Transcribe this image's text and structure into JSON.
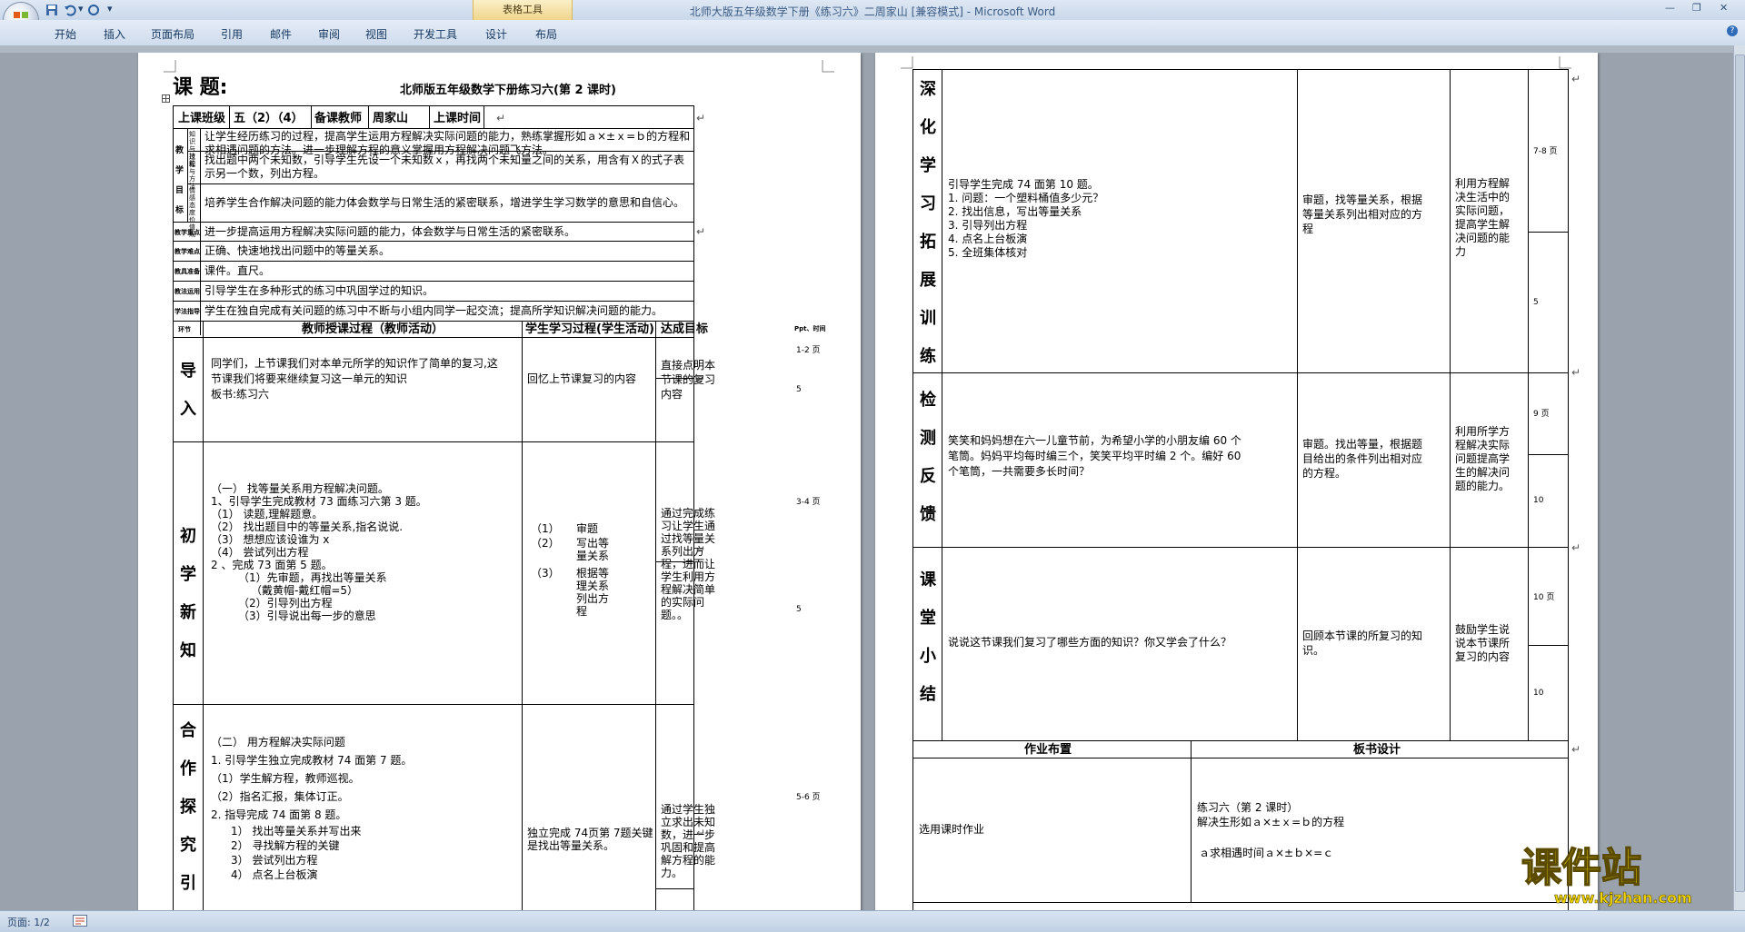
{
  "window": {
    "title": "北师大版五年级数学下册《练习六》二周家山 [兼容模式] - Microsoft Word",
    "context_tab_group": "表格工具"
  },
  "ribbon": {
    "tabs": [
      "开始",
      "插入",
      "页面布局",
      "引用",
      "邮件",
      "审阅",
      "视图",
      "开发工具",
      "设计",
      "布局"
    ]
  },
  "status": {
    "page": "页面: 1/2"
  },
  "watermark": {
    "cn": "课件站",
    "url": "www.kjzhan.com"
  },
  "page1": {
    "heading_label": "课 题:",
    "doc_title": "北师版五年级数学下册练习六(第 2 课时)",
    "info": {
      "class_label": "上课班级",
      "class_value": "五（2）（4）",
      "teacher_label": "备课教师",
      "teacher_value": "周家山",
      "time_label": "上课时间"
    },
    "goals_group": [
      "教",
      "学",
      "目",
      "标"
    ],
    "goals": [
      {
        "sub": "知识与技能",
        "text": "让学生经历练习的过程，提高学生运用方程解决实际问题的能力，熟练掌握形如ａ×±ｘ=ｂ的方程和求相遇问题的方法。进一步理解方程的意义掌握用方程解决问题飞方法。"
      },
      {
        "sub": "过程与方法",
        "text": "找出题中两个未知数，引导学生先设一个未知数ｘ，再找两个未知量之间的关系，用含有Ｘ的式子表示另一个数，列出方程。"
      },
      {
        "sub": "情感态度价值观",
        "text": "培养学生合作解决问题的能力体会数学与日常生活的紧密联系，增进学生学习数学的意思和自信心。"
      }
    ],
    "rows": [
      {
        "label": "教学重点",
        "text": "进一步提高运用方程解决实际问题的能力，体会数学与日常生活的紧密联系。"
      },
      {
        "label": "教学难点",
        "text": "正确、快速地找出问题中的等量关系。"
      },
      {
        "label": "教具准备",
        "text": "课件。直尺。"
      },
      {
        "label": "教法运用",
        "text": "引导学生在多种形式的练习中巩固学过的知识。"
      },
      {
        "label": "学法指导",
        "text": "学生在独自完成有关问题的练习中不断与小组内同学一起交流；提高所学知识解决问题的能力。"
      }
    ],
    "process_header": {
      "step": "环节",
      "teacher": "教师授课过程（教师活动）",
      "student": "学生学习过程(学生活动)",
      "goal": "达成目标",
      "time": "Ppt、时间"
    },
    "sections": [
      {
        "name": [
          "导",
          "入"
        ],
        "teacher": [
          "同学们，上节课我们对本单元所学的知识作了简单的复习,这",
          "节课我们将要来继续复习这一单元的知识",
          "板书:练习六"
        ],
        "student": [
          "回忆上节课复习的内容"
        ],
        "goal": [
          "直接点明本",
          "节课的复习",
          "内容"
        ],
        "time": [
          "1-2 页",
          "5"
        ]
      },
      {
        "name": [
          "初",
          "学",
          "新",
          "知"
        ],
        "teacher": [
          "（一） 找等量关系用方程解决问题。",
          "1、引导学生完成教材 73 面练习六第 3 题。",
          "（1）  读题,理解题意。",
          "（2）  找出题目中的等量关系,指名说说.",
          "（3）  想想应该设谁为 x",
          "（4）  尝试列出方程",
          "2 、完成 73 面第 5 题。",
          "（1）先审题，再找出等量关系",
          "（戴黄帽-戴红帽=5）",
          "（2）引导列出方程",
          "（3）引导说出每一步的意思"
        ],
        "student": [
          "（1）",
          "审题",
          "（2）",
          "写出等",
          "量关系",
          "（3）",
          "根据等",
          "理关系",
          "列出方",
          "程"
        ],
        "goal": [
          "通过完成练",
          "习让学生通",
          "过找等量关",
          "系列出方",
          "程，进而让",
          "学生利用方",
          "程解决简单",
          "的实际问",
          "题。。"
        ],
        "time": [
          "3-4 页",
          "5"
        ]
      },
      {
        "name": [
          "合",
          "作",
          "探",
          "究",
          "引",
          "导"
        ],
        "teacher": [
          "（二） 用方程解决实际问题",
          "1. 引导学生独立完成教材 74 面第 7 题。",
          "（1）学生解方程，教师巡视。",
          "（2）指名汇报，集体订正。",
          "2. 指导完成 74 面第 8 题。",
          "1） 找出等量关系并写出来",
          "2） 寻找解方程的关键",
          "3） 尝试列出方程",
          "4） 点名上台板演"
        ],
        "student": [
          "独立完成 74页第 7题关键",
          "是找出等量关系。"
        ],
        "goal": [
          "通过学生独",
          "立求出未知",
          "数，进一步",
          "巩固和提高",
          "解方程的能",
          "力。"
        ],
        "time": [
          "5-6 页"
        ]
      }
    ]
  },
  "page2": {
    "sections": [
      {
        "name": [
          "深",
          "化",
          "学",
          "习",
          "拓",
          "展",
          "训",
          "练"
        ],
        "teacher": [
          "引导学生完成 74 面第 10 题。",
          "1. 问题：一个塑料桶值多少元？",
          "2. 找出信息，写出等量关系",
          "3. 引导列出方程",
          "4. 点名上台板演",
          "5. 全班集体核对"
        ],
        "student": [
          "审题，找等量关系，根据",
          "等量关系列出相对应的方",
          "程"
        ],
        "goal": [
          "利用方程解",
          "决生活中的",
          "实际问题，",
          "提高学生解",
          "决问题的能",
          "力"
        ],
        "time": [
          "7-8 页",
          "5"
        ]
      },
      {
        "name": [
          "检",
          "测",
          "反",
          "馈"
        ],
        "teacher": [
          "笑笑和妈妈想在六一儿童节前，为希望小学的小朋友编 60 个",
          "笔筒。妈妈平均每时编三个，笑笑平均平时编 2 个。编好 60",
          "个笔筒，一共需要多长时间？"
        ],
        "student": [
          "审题。找出等量，根据题",
          "目给出的条件列出相对应",
          "的方程。"
        ],
        "goal": [
          "利用所学方",
          "程解决实际",
          "问题提高学",
          "生的解决问",
          "题的能力。"
        ],
        "time": [
          "9 页",
          "10"
        ]
      },
      {
        "name": [
          "课",
          "堂",
          "小",
          "结"
        ],
        "teacher": [
          "说说这节课我们复习了哪些方面的知识？你又学会了什么？"
        ],
        "student": [
          "回顾本节课的所复习的知",
          "识。"
        ],
        "goal": [
          "鼓励学生说",
          "说本节课所",
          "复习的内容"
        ],
        "time": [
          "10 页",
          "10"
        ]
      }
    ],
    "homework_label": "作业布置",
    "board_label": "板书设计",
    "homework": "选用课时作业",
    "board": [
      "练习六（第 2 课时）",
      "解决生形如ａ×±ｘ=ｂ的方程",
      "ａ求相遇时间ａ×±ｂ×=ｃ"
    ]
  }
}
